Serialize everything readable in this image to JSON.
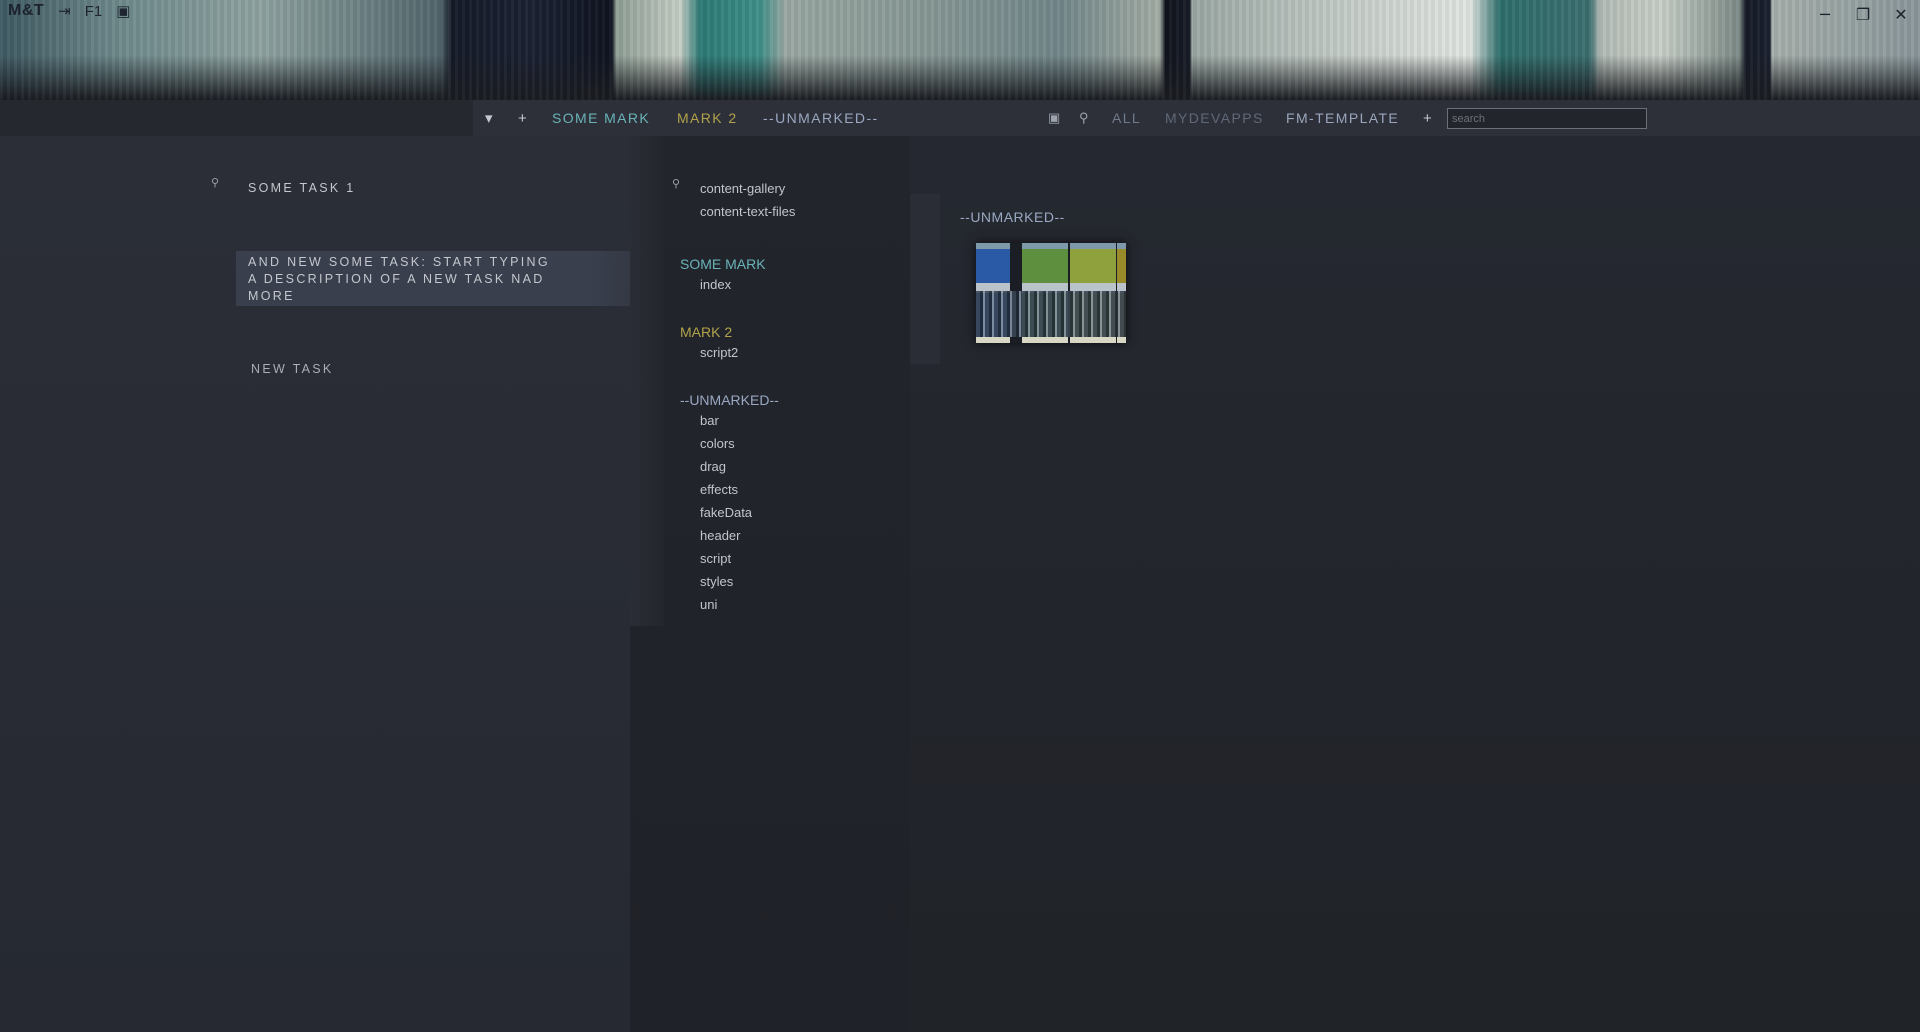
{
  "app": {
    "title": "M&T",
    "f1_label": "F1",
    "icons": [
      "exit-icon",
      "save-icon"
    ]
  },
  "window": {
    "minimize": "─",
    "maximize": "❐",
    "close": "✕"
  },
  "toolbar": {
    "collapse_icon": "▾",
    "add_icon": "+",
    "marks": [
      {
        "label": "SOME MARK",
        "color": "#6ab3b8"
      },
      {
        "label": "MARK 2",
        "color": "#b2a24a"
      },
      {
        "label": "--UNMARKED--",
        "color": "#9aa8c2"
      }
    ],
    "layout_icon": "▣",
    "pin_icon": "⚲",
    "projects": [
      {
        "label": "ALL",
        "color": "#6f7a8a"
      },
      {
        "label": "MYDEVAPPS",
        "color": "#5f6878"
      },
      {
        "label": "FM-TEMPLATE",
        "color": "#9aa6bd"
      }
    ],
    "add_project_icon": "+",
    "search_placeholder": "search"
  },
  "tasks": [
    {
      "label": "SOME TASK 1"
    },
    {
      "label": "AND NEW SOME TASK: START TYPING A DESCRIPTION OF A NEW TASK NAD MORE"
    },
    {
      "label": "NEW TASK"
    }
  ],
  "files": {
    "pinned": [
      "content-gallery",
      "content-text-files"
    ],
    "groups": [
      {
        "label": "SOME MARK",
        "color": "#6ab3b8",
        "items": [
          "index"
        ]
      },
      {
        "label": "MARK 2",
        "color": "#b2a24a",
        "items": [
          "script2"
        ]
      },
      {
        "label": "--UNMARKED--",
        "color": "#9aa8c2",
        "items": [
          "bar",
          "colors",
          "drag",
          "effects",
          "fakeData",
          "header",
          "script",
          "styles",
          "uni"
        ]
      }
    ]
  },
  "gallery": {
    "title": "--UNMARKED--"
  }
}
